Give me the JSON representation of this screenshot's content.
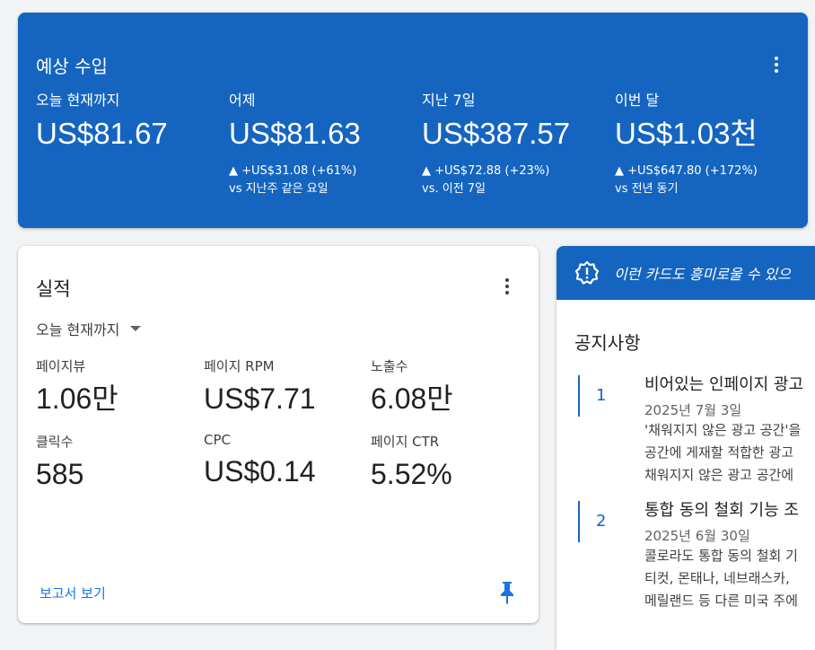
{
  "earnings": {
    "title": "예상 수입",
    "metrics": [
      {
        "label": "오늘 현재까지",
        "value": "US$81.67",
        "delta": "",
        "comparison": ""
      },
      {
        "label": "어제",
        "value": "US$81.63",
        "delta": "▲ +US$31.08 (+61%)",
        "comparison": "vs 지난주 같은 요일"
      },
      {
        "label": "지난 7일",
        "value": "US$387.57",
        "delta": "▲ +US$72.88 (+23%)",
        "comparison": "vs. 이전 7일"
      },
      {
        "label": "이번 달",
        "value": "US$1.03천",
        "delta": "▲ +US$647.80 (+172%)",
        "comparison": "vs 전년 동기"
      }
    ]
  },
  "performance": {
    "title": "실적",
    "range": "오늘 현재까지",
    "stats": [
      {
        "label": "페이지뷰",
        "value": "1.06만"
      },
      {
        "label": "페이지 RPM",
        "value": "US$7.71"
      },
      {
        "label": "노출수",
        "value": "6.08만"
      },
      {
        "label": "클릭수",
        "value": "585"
      },
      {
        "label": "CPC",
        "value": "US$0.14"
      },
      {
        "label": "페이지 CTR",
        "value": "5.52%"
      }
    ],
    "report_link": "보고서 보기"
  },
  "notice": {
    "banner_text": "이런 카드도 흥미로울 수 있으",
    "title": "공지사항",
    "items": [
      {
        "num": "1",
        "head": "비어있는 인페이지 광고",
        "date": "2025년 7월 3일",
        "lines": [
          "'채워지지 않은 광고 공간'을",
          "공간에 게재할 적합한 광고",
          "채워지지 않은 광고 공간에"
        ]
      },
      {
        "num": "2",
        "head": "통합 동의 철회 기능 조",
        "date": "2025년 6월 30일",
        "lines": [
          "콜로라도 통합 동의 철회 기",
          "티컷, 몬태나, 네브래스카,",
          "메릴랜드 등 다른 미국 주에"
        ]
      }
    ]
  },
  "colors": {
    "accent_blue": "#1565c0",
    "link_blue": "#1a73e8"
  },
  "icons": [
    "more-vert-icon",
    "caret-down-icon",
    "pin-icon",
    "badge-alert-icon"
  ]
}
